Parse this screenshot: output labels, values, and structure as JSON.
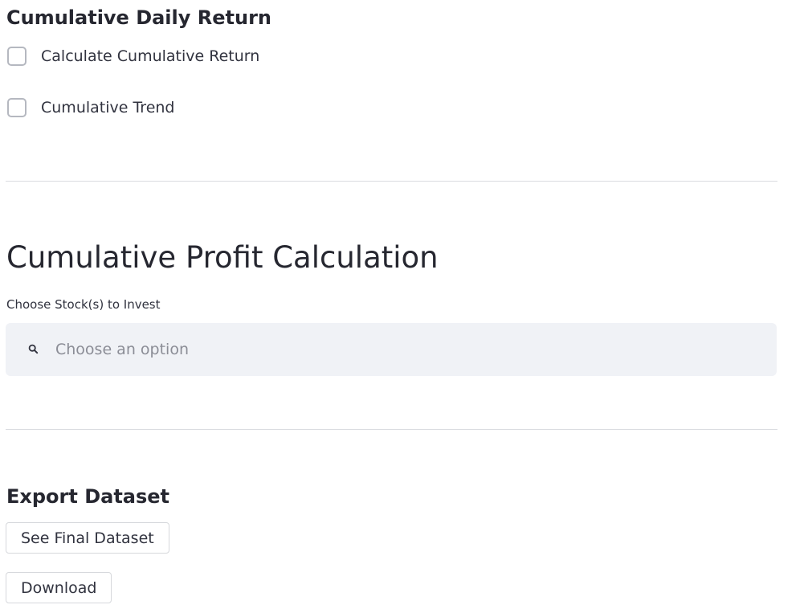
{
  "cumulative_daily_return": {
    "title": "Cumulative Daily Return",
    "checkboxes": [
      {
        "label": "Calculate Cumulative Return",
        "checked": false
      },
      {
        "label": "Cumulative Trend",
        "checked": false
      }
    ]
  },
  "cumulative_profit": {
    "title": "Cumulative Profit Calculation",
    "stock_select": {
      "label": "Choose Stock(s) to Invest",
      "placeholder": "Choose an option",
      "icon": "search-icon"
    }
  },
  "export_dataset": {
    "title": "Export Dataset",
    "see_final_label": "See Final Dataset",
    "download_label": "Download"
  },
  "colors": {
    "text": "#262730",
    "input_bg": "#f0f2f6",
    "placeholder": "#8b8d96",
    "divider": "#dadce0"
  }
}
